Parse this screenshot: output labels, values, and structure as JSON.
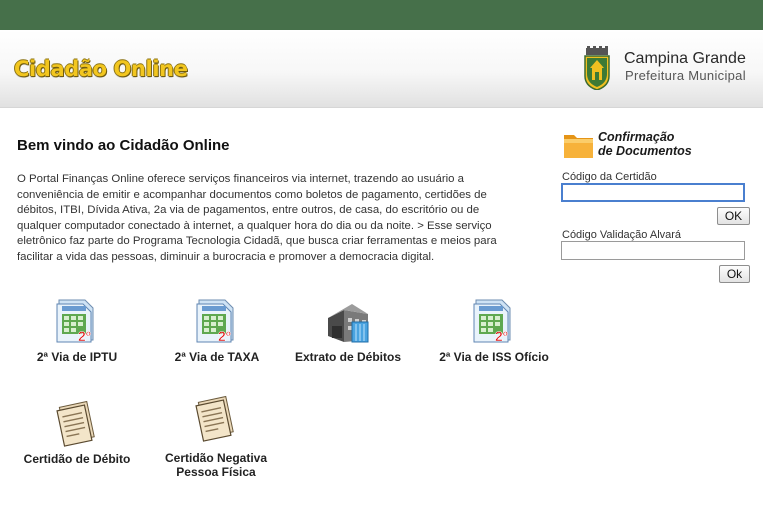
{
  "header": {
    "brand": "Cidadão Online",
    "city_name": "Campina Grande",
    "city_sub": "Prefeitura Municipal"
  },
  "welcome": {
    "title": "Bem vindo ao Cidadão Online",
    "intro": "O Portal Finanças Online oferece serviços financeiros via internet, trazendo ao usuário a conveniência de emitir e acompanhar documentos como boletos de pagamento, certidões de débitos, ITBI, Dívida Ativa, 2a via de pagamentos, entre outros, de casa, do escritório ou de qualquer computador conectado à internet, a qualquer hora do dia ou da noite. > Esse serviço eletrônico faz parte do Programa Tecnologia Cidadã, que busca criar ferramentas e meios para facilitar a vida das pessoas, diminuir a burocracia e promover a democracia digital."
  },
  "services": [
    {
      "label": "2ª Via de IPTU",
      "icon": "iptu-doc-icon",
      "badge": "2º"
    },
    {
      "label": "2ª Via de TAXA",
      "icon": "taxa-doc-icon",
      "badge": "2º"
    },
    {
      "label": "Extrato de Débitos",
      "icon": "extrato-building-icon"
    },
    {
      "label": "2ª Via de ISS Ofício",
      "icon": "iss-doc-icon",
      "badge": "2º"
    },
    {
      "label": "Certidão de Débito",
      "icon": "certidao-paper-icon"
    },
    {
      "label_line1": "Certidão Negativa",
      "label_line2": "Pessoa Física",
      "icon": "certidao-negativa-paper-icon"
    }
  ],
  "sidebar": {
    "title_line1": "Confirmação",
    "title_line2": "de Documentos",
    "certidao_label": "Código da Certidão",
    "certidao_value": "",
    "certidao_ok": "OK",
    "alvara_label": "Código Validação Alvará",
    "alvara_value": "",
    "alvara_ok": "Ok"
  },
  "colors": {
    "topbar": "#46704a",
    "brand_yellow": "#f2c61f",
    "focus_border": "#4a7fcf"
  }
}
